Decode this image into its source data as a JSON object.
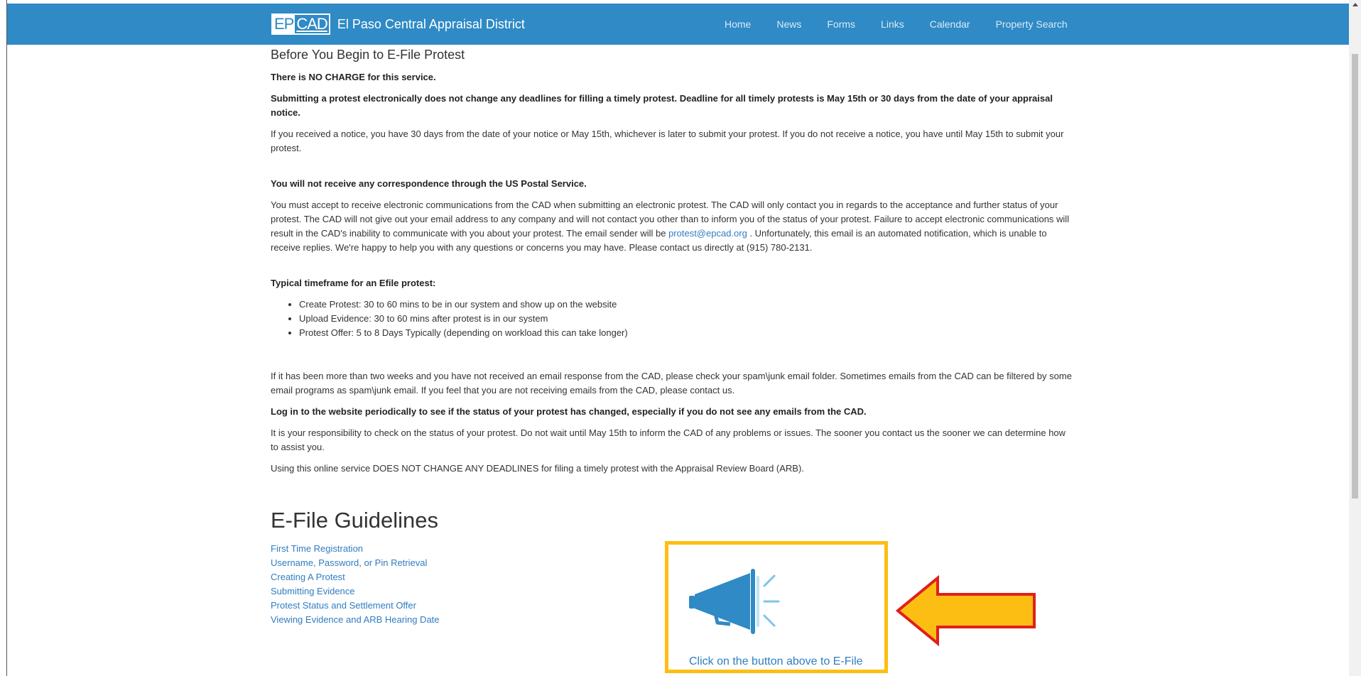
{
  "header": {
    "logo_ep": "EP",
    "logo_cad": "CAD",
    "site_name": "El Paso Central Appraisal District",
    "nav": [
      "Home",
      "News",
      "Forms",
      "Links",
      "Calendar",
      "Property Search"
    ]
  },
  "main": {
    "title": "Before You Begin to E-File Protest",
    "no_charge": "There is NO CHARGE for this service.",
    "deadline_notice": "Submitting a protest electronically does not change any deadlines for filling a timely protest. Deadline for all timely protests is May 15th or 30 days from the date of your appraisal notice.",
    "notice_info": "If you received a notice, you have 30 days from the date of your notice or May 15th, whichever is later to submit your protest. If you do not receive a notice, you have until May 15th to submit your protest.",
    "no_mail_heading": "You will not receive any correspondence through the US Postal Service.",
    "electronic_comm_1": "You must accept to receive electronic communications from the CAD when submitting an electronic protest. The CAD will only contact you in regards to the acceptance and further status of your protest. The CAD will not give out your email address to any company and will not contact you other than to inform you of the status of your protest. Failure to accept electronic communications will result in the CAD's inability to communicate with you about your protest. The email sender will be ",
    "email_link": "protest@epcad.org",
    "electronic_comm_2": " . Unfortunately, this email is an automated notification, which is unable to receive replies. We're happy to help you with any questions or concerns you may have. Please contact us directly at (915) 780-2131.",
    "timeframe_heading": "Typical timeframe for an Efile protest:",
    "timeframe_items": [
      "Create Protest: 30 to 60 mins to be in our system and show up on the website",
      "Upload Evidence: 30 to 60 mins after protest is in our system",
      "Protest Offer: 5 to 8 Days Typically (depending on workload this can take longer)"
    ],
    "spam_notice": "If it has been more than two weeks and you have not received an email response from the CAD, please check your spam\\junk email folder. Sometimes emails from the CAD can be filtered by some email programs as spam\\junk email. If you feel that you are not receiving emails from the CAD, please contact us.",
    "login_notice": "Log in to the website periodically to see if the status of your protest has changed, especially if you do not see any emails from the CAD.",
    "responsibility": "It is your responsibility to check on the status of your protest. Do not wait until May 15th to inform the CAD of any problems or issues. The sooner you contact us the sooner we can determine how to assist you.",
    "deadlines_note": "Using this online service DOES NOT CHANGE ANY DEADLINES for filing a timely protest with the Appraisal Review Board (ARB)."
  },
  "guidelines": {
    "heading": "E-File Guidelines",
    "links": [
      "First Time Registration",
      "Username, Password, or Pin Retrieval",
      "Creating A Protest",
      "Submitting Evidence",
      "Protest Status and Settlement Offer",
      "Viewing Evidence and ARB Hearing Date"
    ]
  },
  "efile": {
    "caption": "Click on the button above to E-File",
    "icon": "megaphone-icon"
  },
  "colors": {
    "navbar": "#2f8ac5",
    "link": "#2f7dc1",
    "highlight_border": "#fdbe13",
    "arrow_fill": "#fdbe13",
    "arrow_stroke": "#e0201b"
  }
}
